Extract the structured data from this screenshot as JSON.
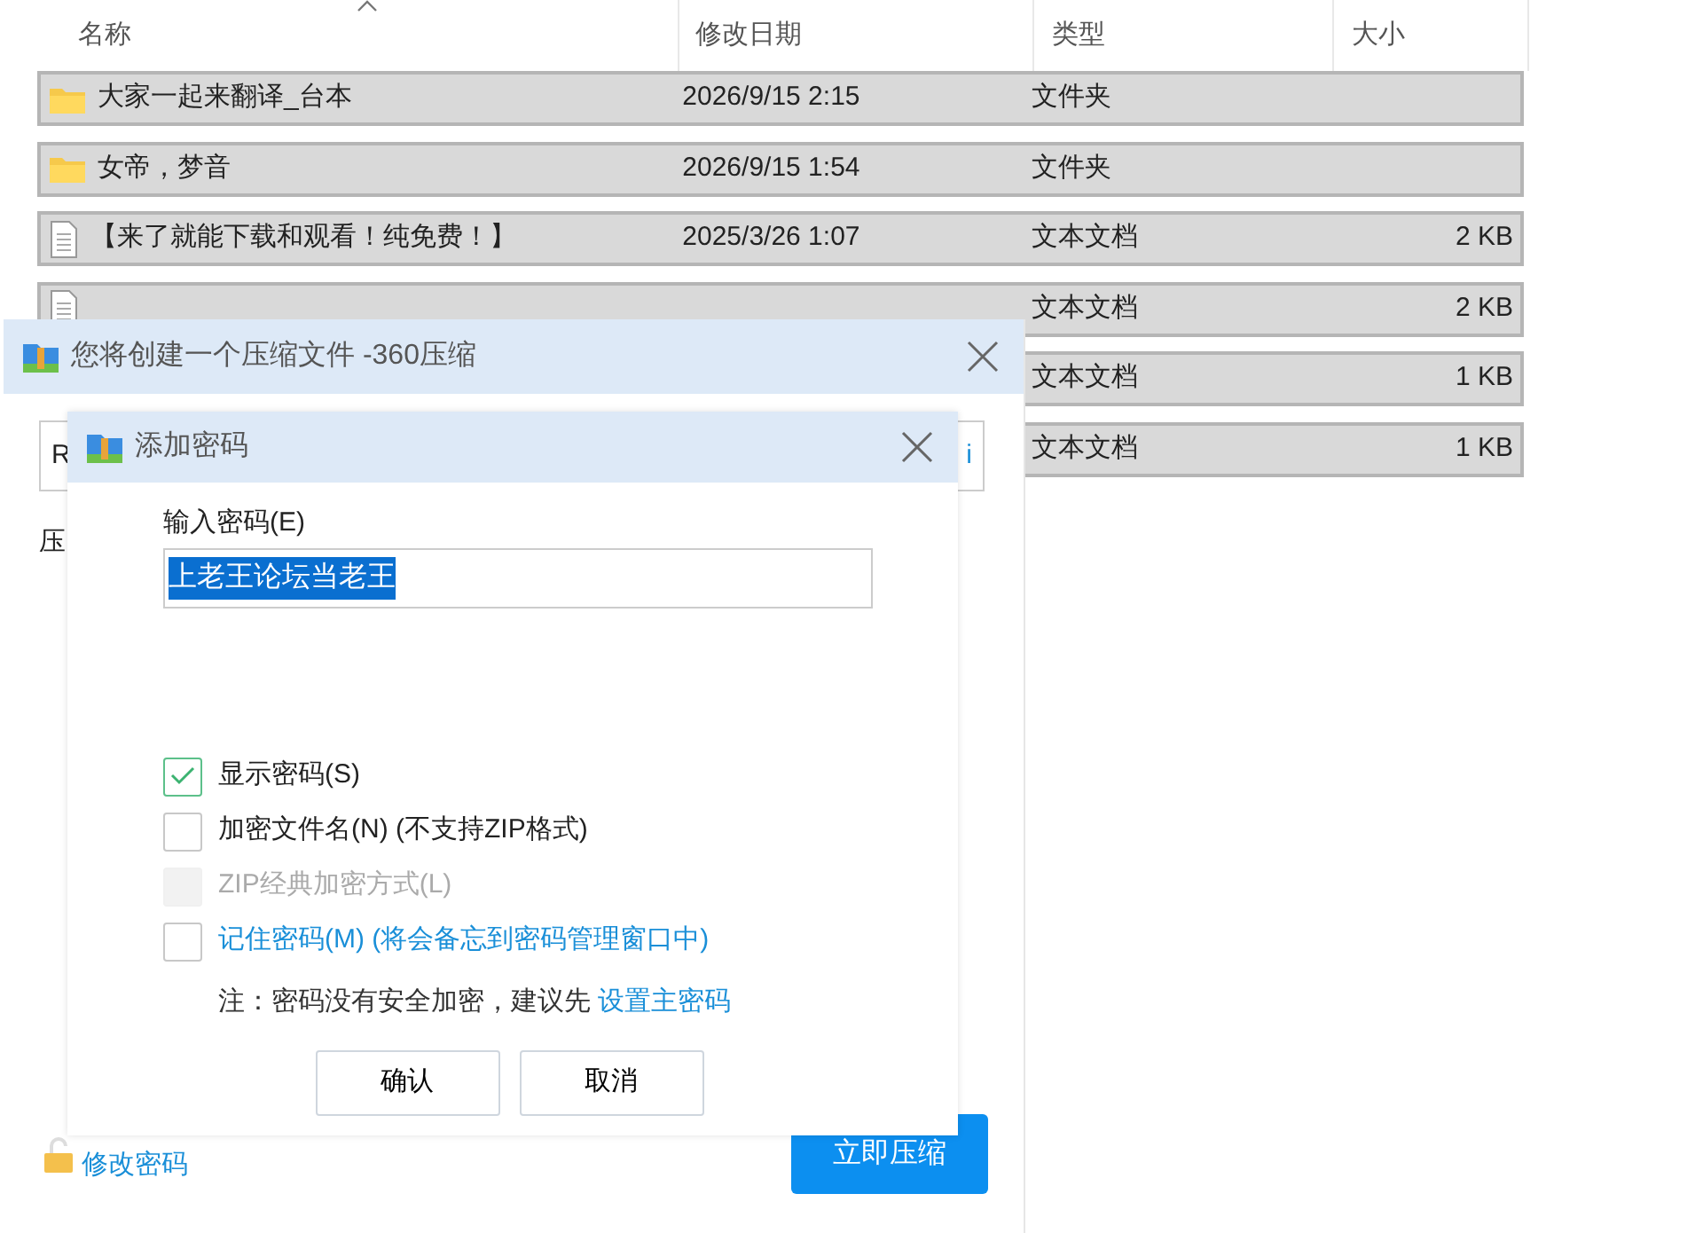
{
  "explorer": {
    "columns": [
      {
        "label": "名称",
        "sorted": true
      },
      {
        "label": "修改日期",
        "sorted": false
      },
      {
        "label": "类型",
        "sorted": false
      },
      {
        "label": "大小",
        "sorted": false
      }
    ],
    "rows": [
      {
        "kind": "folder",
        "name": "大家一起来翻译_台本",
        "date": "2026/9/15 2:15",
        "type": "文件夹",
        "selected": true
      },
      {
        "kind": "folder",
        "name": "女帝，梦音",
        "date": "2026/9/15 1:54",
        "type": "文件夹",
        "selected": true
      },
      {
        "kind": "text",
        "name": "【来了就能下载和观看！纯免费！】",
        "date": "2025/3/26 1:07",
        "type": "文本文档",
        "size": "2 KB",
        "selected": true
      },
      {
        "kind": "text",
        "type": "文本文档",
        "size": "2 KB",
        "selected": true
      },
      {
        "type": "文本文档",
        "size": "1 KB",
        "selected": true
      },
      {
        "type": "文本文档",
        "size": "1 KB",
        "selected": true
      }
    ]
  },
  "compress_dialog": {
    "title": "您将创建一个压缩文件 -360压缩",
    "path_fragment": "R",
    "browse_fragment": "i",
    "label_fragment": "压",
    "change_password_link": "修改密码",
    "compress_button": "立即压缩"
  },
  "password_dialog": {
    "title": "添加密码",
    "password_label": "输入密码(E)",
    "password_value": "上老王论坛当老王",
    "password_selected": true,
    "options": [
      {
        "kind": "plain",
        "label": "显示密码(S)",
        "checked": true,
        "disabled": false
      },
      {
        "kind": "plain",
        "label": "加密文件名(N) (不支持ZIP格式)",
        "checked": false,
        "disabled": false
      },
      {
        "kind": "plain",
        "label": "ZIP经典加密方式(L)",
        "checked": false,
        "disabled": true
      },
      {
        "kind": "link",
        "label": "记住密码(M) (将会备忘到密码管理窗口中)",
        "checked": false,
        "disabled": false
      }
    ],
    "note": "注：密码没有安全加密，建议先",
    "note_link": "设置主密码",
    "buttons": [
      "确认",
      "取消"
    ]
  }
}
